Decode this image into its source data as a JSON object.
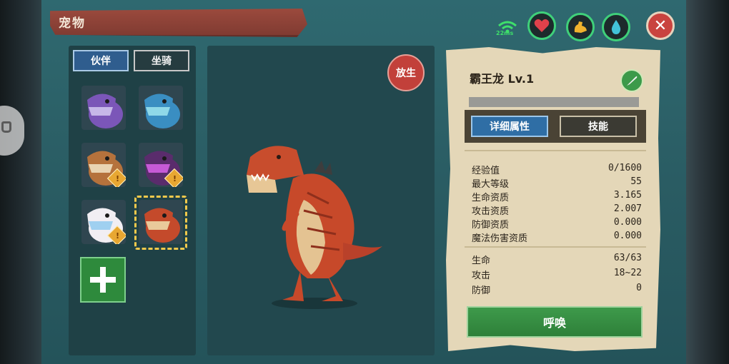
{
  "window": {
    "title": "宠物"
  },
  "status": {
    "ping": "22ms"
  },
  "top_buttons": [
    {
      "name": "heart",
      "color": "#e0414b"
    },
    {
      "name": "strength",
      "color": "#f0b22e"
    },
    {
      "name": "water-drop",
      "color": "#42c2d8"
    }
  ],
  "tabs": {
    "partner": "伙伴",
    "mount": "坐骑"
  },
  "pets": [
    {
      "name": "purple-trex",
      "body": "#7b56b8",
      "accent": "#c6b7e8",
      "badge": false
    },
    {
      "name": "blue-frill-dino",
      "body": "#3a8ec2",
      "accent": "#8fd8e8",
      "badge": false
    },
    {
      "name": "armored-wolf",
      "body": "#b5723c",
      "accent": "#e9d4b2",
      "badge": true
    },
    {
      "name": "purple-beast",
      "body": "#5a2c6c",
      "accent": "#c65ad6",
      "badge": true
    },
    {
      "name": "white-rabbit",
      "body": "#f1eef3",
      "accent": "#9fd0f0",
      "badge": true
    },
    {
      "name": "red-trex",
      "body": "#c44a2b",
      "accent": "#e9c99a",
      "badge": false,
      "selected": true
    }
  ],
  "actions": {
    "release": "放生",
    "summon": "呼唤"
  },
  "pet_info": {
    "name": "霸王龙 Lv.1",
    "tabs": {
      "details": "详细属性",
      "skills": "技能"
    },
    "stats_primary": [
      {
        "label": "经验值",
        "value": "0/1600"
      },
      {
        "label": "最大等级",
        "value": "55"
      },
      {
        "label": "生命资质",
        "value": "3.165"
      },
      {
        "label": "攻击资质",
        "value": "2.007"
      },
      {
        "label": "防御资质",
        "value": "0.000"
      },
      {
        "label": "魔法伤害资质",
        "value": "0.000"
      }
    ],
    "stats_secondary": [
      {
        "label": "生命",
        "value": "63/63"
      },
      {
        "label": "攻击",
        "value": "18~22"
      },
      {
        "label": "防御",
        "value": "0"
      }
    ]
  }
}
